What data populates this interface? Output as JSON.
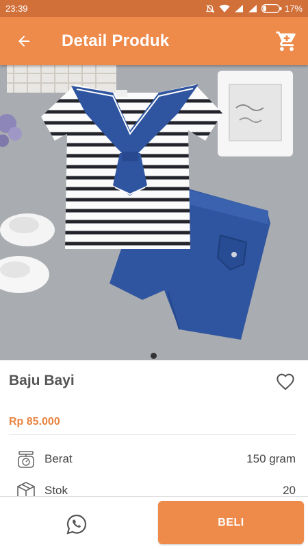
{
  "status_bar": {
    "time": "23:39",
    "battery_percent": "17%"
  },
  "app_bar": {
    "title": "Detail Produk",
    "back_icon": "arrow-left-icon",
    "cart_icon": "shopping-cart-icon"
  },
  "product": {
    "name": "Baju Bayi",
    "price": "Rp 85.000",
    "image_alt": "product-photo",
    "gallery_current_page": 1,
    "specs": [
      {
        "icon": "scale-icon",
        "label": "Berat",
        "value": "150 gram"
      },
      {
        "icon": "box-icon",
        "label": "Stok",
        "value": "20"
      }
    ]
  },
  "bottom_bar": {
    "whatsapp_icon": "whatsapp-icon",
    "buy_label": "BELI"
  },
  "colors": {
    "primary": "#ee8a4a",
    "status_bar": "#d2703a",
    "price": "#e8833f"
  }
}
